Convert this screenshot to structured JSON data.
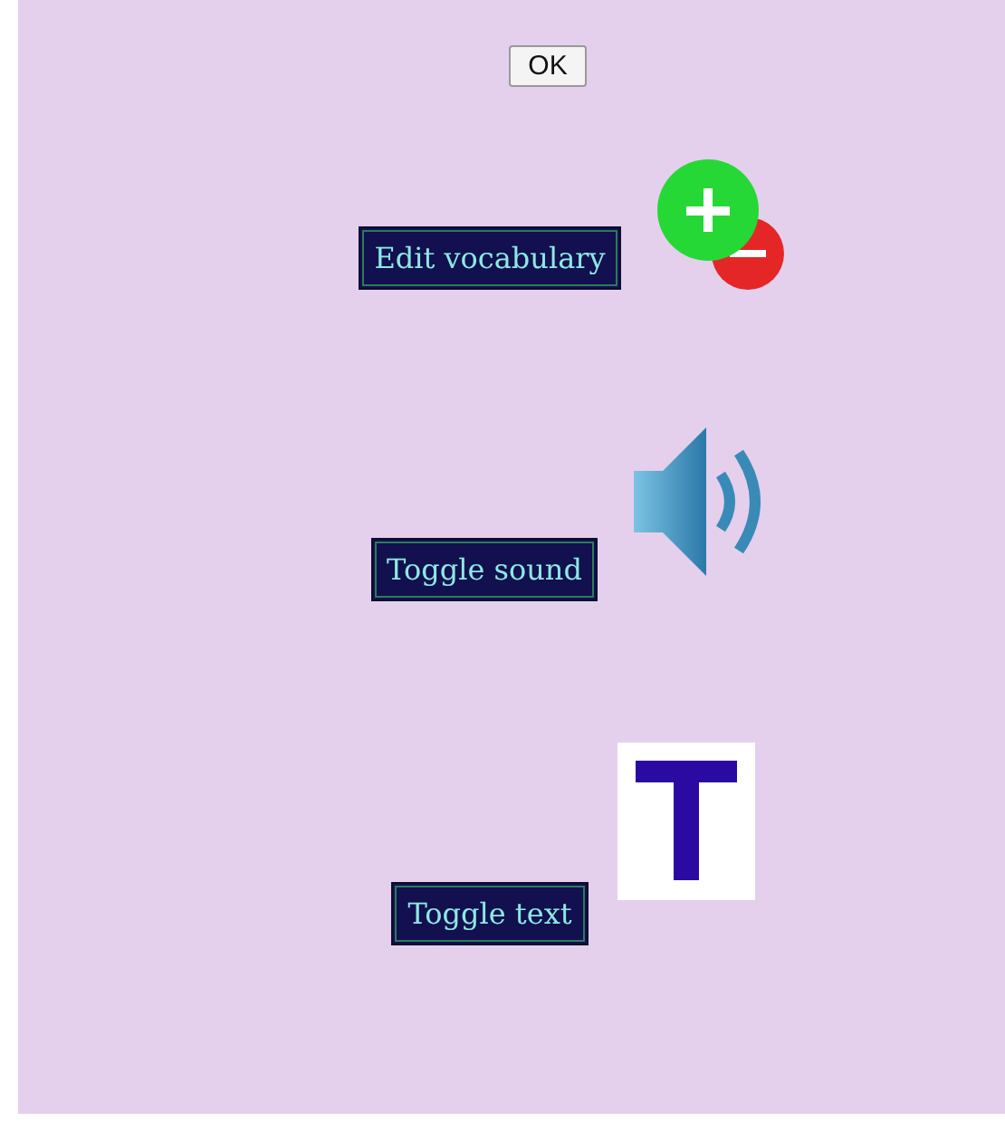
{
  "ok_button": {
    "label": "OK"
  },
  "actions": [
    {
      "kind": "vocabulary",
      "label": "Edit vocabulary"
    },
    {
      "kind": "sound",
      "label": "Toggle sound"
    },
    {
      "kind": "text",
      "label": "Toggle text"
    }
  ]
}
